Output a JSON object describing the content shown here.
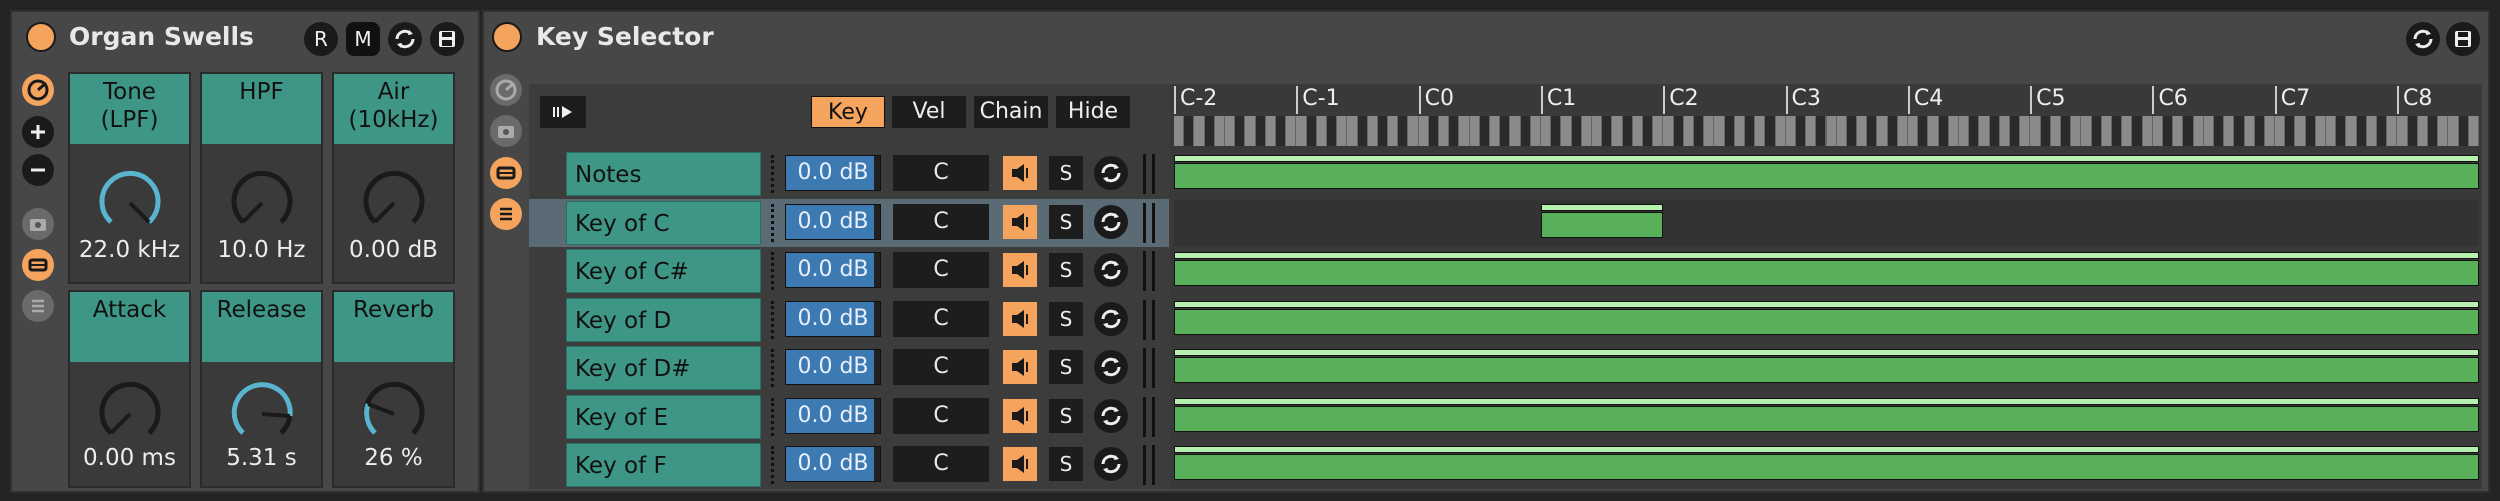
{
  "organ_swells": {
    "title": "Organ Swells",
    "header_buttons": {
      "r_label": "R",
      "m_label": "M"
    },
    "macros": [
      {
        "name_line1": "Tone",
        "name_line2": "(LPF)",
        "value": "22.0 kHz",
        "level": 1.0
      },
      {
        "name_line1": "HPF",
        "name_line2": "",
        "value": "10.0 Hz",
        "level": 0.0
      },
      {
        "name_line1": "Air",
        "name_line2": "(10kHz)",
        "value": "0.00 dB",
        "level": 0.0
      },
      {
        "name_line1": "Attack",
        "name_line2": "",
        "value": "0.00 ms",
        "level": 0.0
      },
      {
        "name_line1": "Release",
        "name_line2": "",
        "value": "5.31 s",
        "level": 0.6
      },
      {
        "name_line1": "Reverb",
        "name_line2": "",
        "value": "26 %",
        "level": 0.26
      }
    ]
  },
  "key_selector": {
    "title": "Key Selector",
    "tabs": [
      {
        "label": "Key",
        "active": true
      },
      {
        "label": "Vel",
        "active": false
      },
      {
        "label": "Chain",
        "active": false
      },
      {
        "label": "Hide",
        "active": false
      }
    ],
    "octave_labels": [
      "C-2",
      "C-1",
      "C0",
      "C1",
      "C2",
      "C3",
      "C4",
      "C5",
      "C6",
      "C7",
      "C8"
    ],
    "chains": [
      {
        "name": "Notes",
        "volume": "0.0 dB",
        "key": "C",
        "solo_label": "S",
        "selected": false,
        "range": [
          0,
          127
        ]
      },
      {
        "name": "Key of C",
        "volume": "0.0 dB",
        "key": "C",
        "solo_label": "S",
        "selected": true,
        "range": [
          36,
          47
        ]
      },
      {
        "name": "Key of C#",
        "volume": "0.0 dB",
        "key": "C",
        "solo_label": "S",
        "selected": false,
        "range": [
          0,
          127
        ]
      },
      {
        "name": "Key of D",
        "volume": "0.0 dB",
        "key": "C",
        "solo_label": "S",
        "selected": false,
        "range": [
          0,
          127
        ]
      },
      {
        "name": "Key of D#",
        "volume": "0.0 dB",
        "key": "C",
        "solo_label": "S",
        "selected": false,
        "range": [
          0,
          127
        ]
      },
      {
        "name": "Key of E",
        "volume": "0.0 dB",
        "key": "C",
        "solo_label": "S",
        "selected": false,
        "range": [
          0,
          127
        ]
      },
      {
        "name": "Key of F",
        "volume": "0.0 dB",
        "key": "C",
        "solo_label": "S",
        "selected": false,
        "range": [
          0,
          127
        ]
      }
    ]
  },
  "colors": {
    "accent": "#f5a45d",
    "chain_name_bg": "#3e9686",
    "range_green": "#58b05b",
    "volume_blue": "#3c7ab1",
    "knob_arc": "#5ab4d0"
  }
}
